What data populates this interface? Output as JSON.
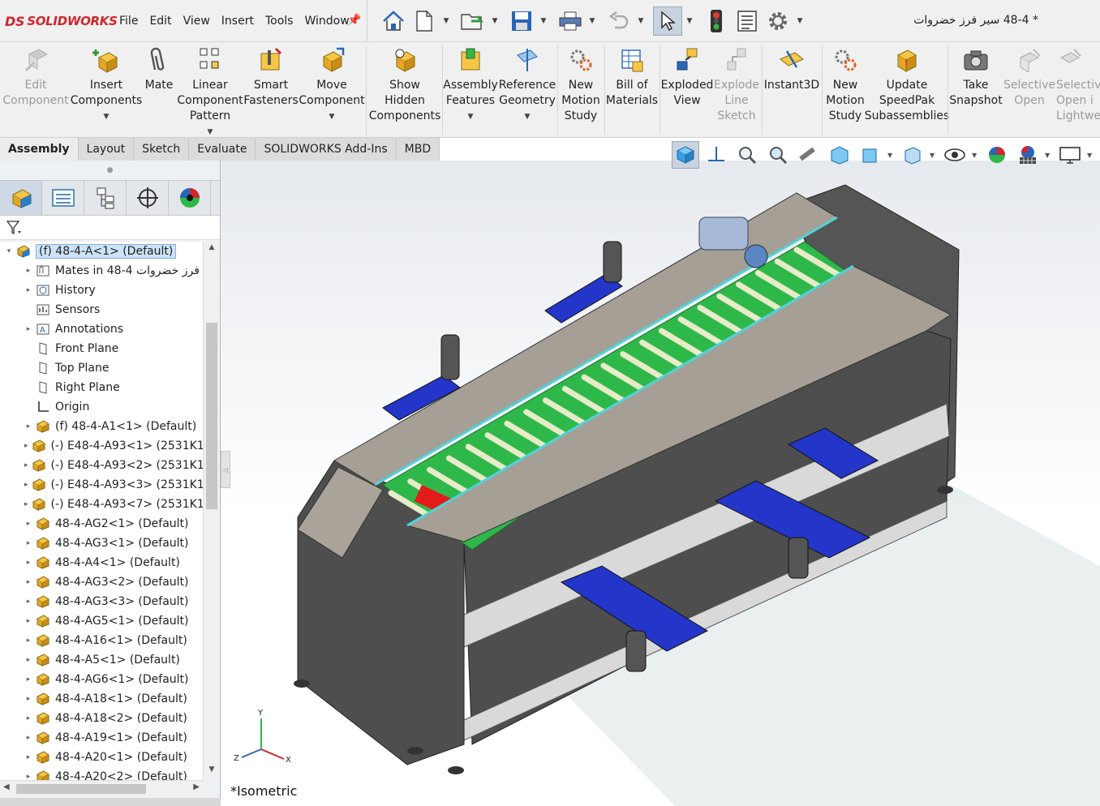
{
  "app": {
    "logo_text": "SOLIDWORKS",
    "logo_mark": "DS"
  },
  "menu": [
    "File",
    "Edit",
    "View",
    "Insert",
    "Tools",
    "Window"
  ],
  "document_title": "* 48-4 سیر فرز خضروات",
  "quick_toolbar": [
    "home-icon",
    "new-document-icon",
    "open-icon",
    "save-icon",
    "print-icon",
    "undo-icon",
    "select-pointer-icon",
    "rebuild-icon",
    "file-properties-icon",
    "options-gear-icon"
  ],
  "ribbon": {
    "edit_component": "Edit\nComponent",
    "insert_components": "Insert\nComponents",
    "mate": "Mate",
    "linear_pattern": "Linear\nComponent\nPattern",
    "smart_fasteners": "Smart\nFasteners",
    "move_component": "Move\nComponent",
    "show_hidden": "Show\nHidden\nComponents",
    "assembly_features": "Assembly\nFeatures",
    "reference_geometry": "Reference\nGeometry",
    "new_motion_study": "New\nMotion\nStudy",
    "bill_of_materials": "Bill of\nMaterials",
    "exploded_view": "Exploded\nView",
    "explode_line_sketch": "Explode\nLine\nSketch",
    "instant3d": "Instant3D",
    "new_motion_study_2": "New\nMotion\nStudy",
    "update_speedpak": "Update\nSpeedPak\nSubassemblies",
    "take_snapshot": "Take\nSnapshot",
    "selective_open": "Selective\nOpen",
    "selective_open_lightweight": "Selective\nOpen i\nLightwei"
  },
  "command_tabs": [
    "Assembly",
    "Layout",
    "Sketch",
    "Evaluate",
    "SOLIDWORKS Add-Ins",
    "MBD"
  ],
  "active_tab": "Assembly",
  "view_toolbar": [
    "view-cube-icon",
    "normal-to-icon",
    "zoom-to-fit-icon",
    "zoom-area-icon",
    "previous-view-icon",
    "section-view-icon",
    "view-orientation-icon",
    "display-style-icon",
    "hide-show-icon",
    "appearance-icon",
    "scene-icon",
    "display-settings-icon"
  ],
  "panel_tabs": [
    "feature-manager-icon",
    "property-manager-icon",
    "configuration-manager-icon",
    "dimxpert-icon",
    "display-manager-icon"
  ],
  "tree": {
    "root": "(f) 48-4-A<1> (Default)",
    "items": [
      {
        "label": "Mates in 48-4 فرز خضروات",
        "icon": "mates-icon",
        "expand": true
      },
      {
        "label": "History",
        "icon": "history-icon",
        "expand": true
      },
      {
        "label": "Sensors",
        "icon": "sensors-icon",
        "expand": false
      },
      {
        "label": "Annotations",
        "icon": "annotations-icon",
        "expand": true
      },
      {
        "label": "Front Plane",
        "icon": "plane-icon",
        "expand": false
      },
      {
        "label": "Top Plane",
        "icon": "plane-icon",
        "expand": false
      },
      {
        "label": "Right Plane",
        "icon": "plane-icon",
        "expand": false
      },
      {
        "label": "Origin",
        "icon": "origin-icon",
        "expand": false
      },
      {
        "label": "(f) 48-4-A1<1> (Default)",
        "icon": "subassembly-icon",
        "expand": true
      },
      {
        "label": "(-) E48-4-A93<1> (2531K1",
        "icon": "subassembly-icon",
        "expand": true
      },
      {
        "label": "(-) E48-4-A93<2> (2531K1",
        "icon": "subassembly-icon",
        "expand": true
      },
      {
        "label": "(-) E48-4-A93<3> (2531K1",
        "icon": "subassembly-icon",
        "expand": true
      },
      {
        "label": "(-) E48-4-A93<7> (2531K1",
        "icon": "subassembly-icon",
        "expand": true
      },
      {
        "label": "48-4-AG2<1> (Default)",
        "icon": "subassembly-icon",
        "expand": true
      },
      {
        "label": "48-4-AG3<1> (Default)",
        "icon": "subassembly-icon",
        "expand": true
      },
      {
        "label": "48-4-A4<1> (Default)",
        "icon": "subassembly-icon",
        "expand": true
      },
      {
        "label": "48-4-AG3<2> (Default)",
        "icon": "subassembly-icon",
        "expand": true
      },
      {
        "label": "48-4-AG3<3> (Default)",
        "icon": "subassembly-icon",
        "expand": true
      },
      {
        "label": "48-4-AG5<1> (Default)",
        "icon": "subassembly-icon",
        "expand": true
      },
      {
        "label": "48-4-A16<1> (Default)",
        "icon": "subassembly-icon",
        "expand": true
      },
      {
        "label": "48-4-A5<1> (Default)",
        "icon": "subassembly-icon",
        "expand": true
      },
      {
        "label": "48-4-AG6<1> (Default)",
        "icon": "subassembly-icon",
        "expand": true
      },
      {
        "label": "48-4-A18<1> (Default)",
        "icon": "subassembly-icon",
        "expand": true
      },
      {
        "label": "48-4-A18<2> (Default)",
        "icon": "subassembly-icon",
        "expand": true
      },
      {
        "label": "48-4-A19<1> (Default)",
        "icon": "subassembly-icon",
        "expand": true
      },
      {
        "label": "48-4-A20<1> (Default)",
        "icon": "subassembly-icon",
        "expand": true
      },
      {
        "label": "48-4-A20<2> (Default)",
        "icon": "subassembly-icon",
        "expand": true
      }
    ]
  },
  "viewport": {
    "view_name": "*Isometric",
    "axes": [
      "X",
      "Y",
      "Z"
    ]
  },
  "colors": {
    "brand": "#d1262c",
    "belt": "#2436c9",
    "frame_green": "#2fb84a",
    "roller": "#e8ebc8",
    "panel_dark": "#4a4a4a",
    "panel_top": "#a59f96",
    "highlight": "#e31b1b"
  }
}
